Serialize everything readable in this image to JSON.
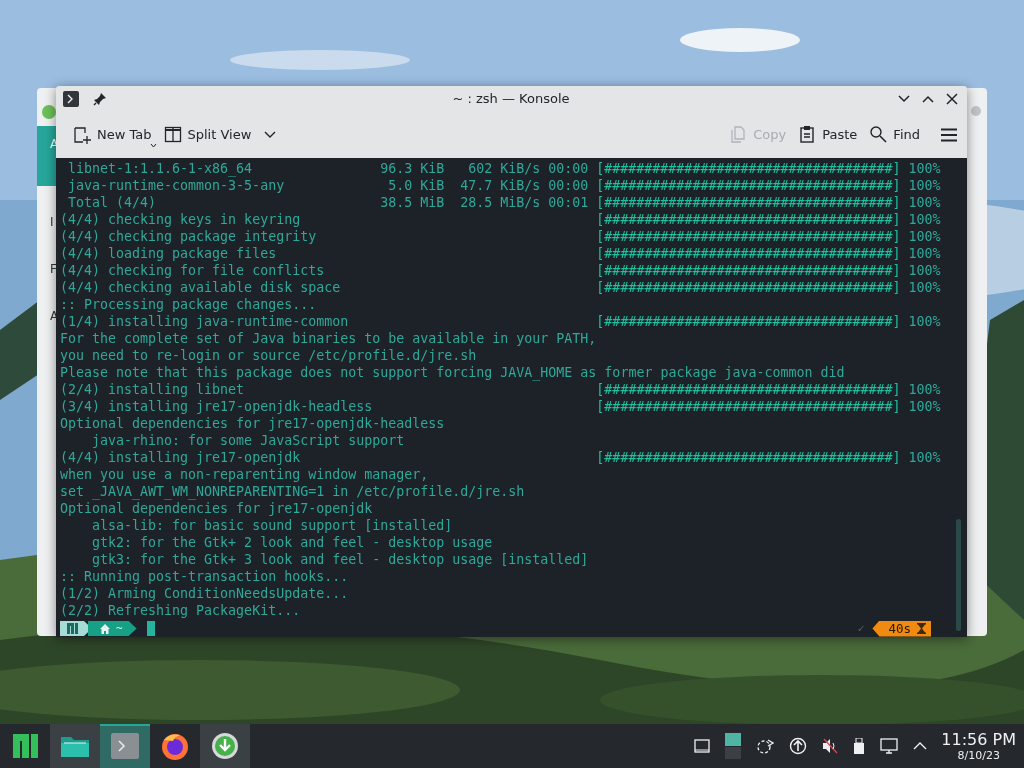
{
  "background_window": {
    "fragments": [
      {
        "text": "A",
        "selected": true
      },
      {
        "text": "I",
        "selected": false
      },
      {
        "text": "F",
        "selected": false
      },
      {
        "text": "A",
        "selected": false
      }
    ]
  },
  "window": {
    "title": "~ : zsh — Konsole"
  },
  "toolbar": {
    "left": [
      {
        "kind": "new-tab",
        "label": "New Tab",
        "disabled": false
      },
      {
        "kind": "split-view",
        "label": "Split View",
        "disabled": false
      }
    ],
    "right": [
      {
        "kind": "copy",
        "label": "Copy",
        "disabled": true
      },
      {
        "kind": "paste",
        "label": "Paste",
        "disabled": false
      },
      {
        "kind": "find",
        "label": "Find",
        "disabled": false
      }
    ]
  },
  "terminal": {
    "lines": [
      {
        "kind": "download",
        "package": "libnet-1:1.1.6-1-x86_64",
        "size": "96.3 KiB",
        "speed": "602 KiB/s",
        "eta": "00:00",
        "bar": "[####################################]",
        "percent": "100%"
      },
      {
        "kind": "download",
        "package": "java-runtime-common-3-5-any",
        "size": "5.0 KiB",
        "speed": "47.7 KiB/s",
        "eta": "00:00",
        "bar": "[####################################]",
        "percent": "100%"
      },
      {
        "kind": "download",
        "package": "Total (4/4)",
        "size": "38.5 MiB",
        "speed": "28.5 MiB/s",
        "eta": "00:01",
        "bar": "[####################################]",
        "percent": "100%"
      },
      {
        "kind": "progress",
        "text": "(4/4) checking keys in keyring",
        "bar": "[####################################]",
        "percent": "100%"
      },
      {
        "kind": "progress",
        "text": "(4/4) checking package integrity",
        "bar": "[####################################]",
        "percent": "100%"
      },
      {
        "kind": "progress",
        "text": "(4/4) loading package files",
        "bar": "[####################################]",
        "percent": "100%"
      },
      {
        "kind": "progress",
        "text": "(4/4) checking for file conflicts",
        "bar": "[####################################]",
        "percent": "100%"
      },
      {
        "kind": "progress",
        "text": "(4/4) checking available disk space",
        "bar": "[####################################]",
        "percent": "100%"
      },
      {
        "kind": "plain",
        "text": ":: Processing package changes..."
      },
      {
        "kind": "progress",
        "text": "(1/4) installing java-runtime-common",
        "bar": "[####################################]",
        "percent": "100%"
      },
      {
        "kind": "plain",
        "text": "For the complete set of Java binaries to be available in your PATH,"
      },
      {
        "kind": "plain",
        "text": "you need to re-login or source /etc/profile.d/jre.sh"
      },
      {
        "kind": "plain",
        "text": "Please note that this package does not support forcing JAVA_HOME as former package java-common did"
      },
      {
        "kind": "progress",
        "text": "(2/4) installing libnet",
        "bar": "[####################################]",
        "percent": "100%"
      },
      {
        "kind": "progress",
        "text": "(3/4) installing jre17-openjdk-headless",
        "bar": "[####################################]",
        "percent": "100%"
      },
      {
        "kind": "plain",
        "text": "Optional dependencies for jre17-openjdk-headless"
      },
      {
        "kind": "plain",
        "text": "    java-rhino: for some JavaScript support"
      },
      {
        "kind": "progress",
        "text": "(4/4) installing jre17-openjdk",
        "bar": "[####################################]",
        "percent": "100%"
      },
      {
        "kind": "plain",
        "text": "when you use a non-reparenting window manager,"
      },
      {
        "kind": "plain",
        "text": "set _JAVA_AWT_WM_NONREPARENTING=1 in /etc/profile.d/jre.sh"
      },
      {
        "kind": "plain",
        "text": "Optional dependencies for jre17-openjdk"
      },
      {
        "kind": "plain",
        "text": "    alsa-lib: for basic sound support [installed]"
      },
      {
        "kind": "plain",
        "text": "    gtk2: for the Gtk+ 2 look and feel - desktop usage"
      },
      {
        "kind": "plain",
        "text": "    gtk3: for the Gtk+ 3 look and feel - desktop usage [installed]"
      },
      {
        "kind": "plain",
        "text": ":: Running post-transaction hooks..."
      },
      {
        "kind": "plain",
        "text": "(1/2) Arming ConditionNeedsUpdate..."
      },
      {
        "kind": "plain",
        "text": "(2/2) Refreshing PackageKit..."
      }
    ],
    "prompt": {
      "dir": "~",
      "status": "✓",
      "duration": "40s"
    }
  },
  "taskbar": {
    "tasks": [
      {
        "kind": "launcher",
        "selected": false,
        "running": false
      },
      {
        "kind": "files",
        "selected": false,
        "running": true
      },
      {
        "kind": "terminal",
        "selected": true,
        "running": true
      },
      {
        "kind": "browser",
        "selected": false,
        "running": false
      },
      {
        "kind": "downloader",
        "selected": false,
        "running": true
      }
    ],
    "tray": [
      {
        "kind": "window"
      },
      {
        "kind": "battery"
      },
      {
        "kind": "network"
      },
      {
        "kind": "updates"
      },
      {
        "kind": "muted"
      },
      {
        "kind": "usb"
      },
      {
        "kind": "display"
      },
      {
        "kind": "expand"
      }
    ],
    "clock": {
      "time": "11:56 PM",
      "date": "8/10/23"
    }
  }
}
